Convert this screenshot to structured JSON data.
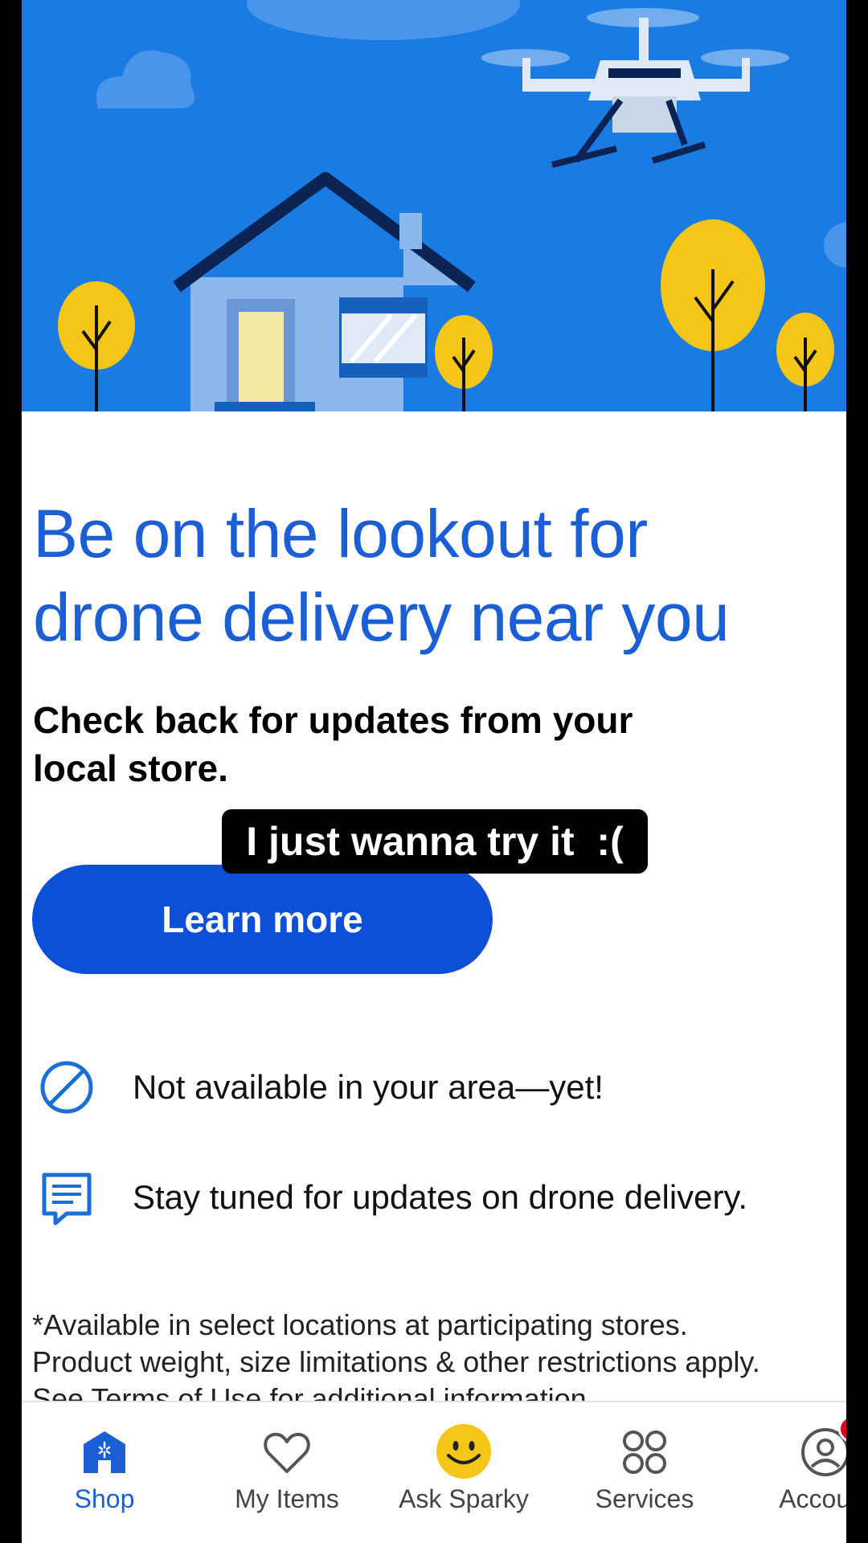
{
  "hero": {
    "alt_icon": "drone-delivery-illustration"
  },
  "content": {
    "headline_line1": "Be on the lookout for",
    "headline_line2": "drone delivery near you",
    "subhead_line1": "Check back for updates from your",
    "subhead_line2": "local store.",
    "overlay_caption": "I just wanna try it  :(",
    "learn_more_label": "Learn more"
  },
  "info": [
    {
      "icon": "prohibited-icon",
      "text": "Not available in your area—yet!"
    },
    {
      "icon": "chat-message-icon",
      "text": "Stay tuned for updates on drone delivery."
    }
  ],
  "disclaimer": {
    "line1": "*Available in select locations at participating stores.",
    "line2": "Product weight, size limitations & other restrictions apply.",
    "line3": "See Terms of Use for additional information."
  },
  "tabbar": {
    "tabs": [
      {
        "label": "Shop",
        "icon": "store-icon",
        "active": true
      },
      {
        "label": "My Items",
        "icon": "heart-icon",
        "active": false
      },
      {
        "label": "Ask Sparky",
        "icon": "smiley-icon",
        "active": false
      },
      {
        "label": "Services",
        "icon": "grid-circles-icon",
        "active": false
      },
      {
        "label": "Account",
        "icon": "account-icon",
        "active": false,
        "notification": true
      }
    ]
  },
  "colors": {
    "brand_blue": "#1b5fd6",
    "button_blue": "#0e4fd8",
    "hero_sky": "#1a7be3",
    "spark_yellow": "#f5c518",
    "badge_red": "#e3001b"
  }
}
